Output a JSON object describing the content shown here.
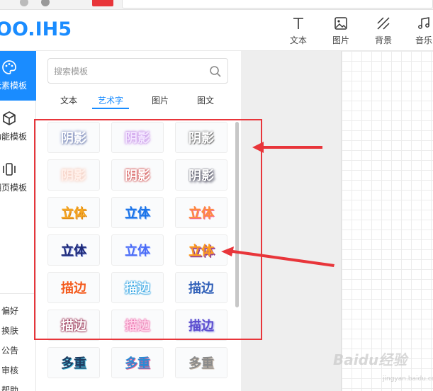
{
  "app": {
    "logo_text": "OO.IH5"
  },
  "toolbar": {
    "items": [
      {
        "label": "文本",
        "icon": "text-icon"
      },
      {
        "label": "图片",
        "icon": "image-icon"
      },
      {
        "label": "背景",
        "icon": "background-icon"
      },
      {
        "label": "音乐",
        "icon": "music-icon"
      }
    ]
  },
  "leftnav": {
    "items": [
      {
        "label": "元素模板",
        "icon": "palette-icon",
        "active": true
      },
      {
        "label": "功能模板",
        "icon": "cube-icon",
        "active": false
      },
      {
        "label": "翻页模板",
        "icon": "pages-icon",
        "active": false
      }
    ],
    "bottom": [
      "偏好",
      "换肤",
      "公告",
      "审核",
      "帮助"
    ]
  },
  "panel": {
    "search_placeholder": "搜索模板",
    "tabs": [
      {
        "label": "文本",
        "active": false
      },
      {
        "label": "艺术字",
        "active": true
      },
      {
        "label": "图片",
        "active": false
      },
      {
        "label": "图文",
        "active": false
      }
    ],
    "templates": [
      {
        "text": "阴影",
        "style": "s-shadow1"
      },
      {
        "text": "阴影",
        "style": "s-shadow2"
      },
      {
        "text": "阴影",
        "style": "s-shadow3"
      },
      {
        "text": "阴影",
        "style": "s-shadow4"
      },
      {
        "text": "阴影",
        "style": "s-shadow5"
      },
      {
        "text": "阴影",
        "style": "s-shadow6"
      },
      {
        "text": "立体",
        "style": "s-3d1"
      },
      {
        "text": "立体",
        "style": "s-3d2"
      },
      {
        "text": "立体",
        "style": "s-3d3"
      },
      {
        "text": "立体",
        "style": "s-3d4"
      },
      {
        "text": "立体",
        "style": "s-3d5"
      },
      {
        "text": "立体",
        "style": "s-3d6"
      },
      {
        "text": "描边",
        "style": "s-st1"
      },
      {
        "text": "描边",
        "style": "s-st2"
      },
      {
        "text": "描边",
        "style": "s-st3"
      },
      {
        "text": "描边",
        "style": "s-st4"
      },
      {
        "text": "描边",
        "style": "s-st5"
      },
      {
        "text": "描边",
        "style": "s-st6"
      },
      {
        "text": "多重",
        "style": "s-m1"
      },
      {
        "text": "多重",
        "style": "s-m2"
      },
      {
        "text": "多重",
        "style": "s-m3"
      }
    ]
  },
  "colors": {
    "accent": "#1a8cff",
    "annotation_red": "#e8353a"
  },
  "watermark": {
    "text": "Baidu经验",
    "sub": "jingyan.baidu.com"
  }
}
